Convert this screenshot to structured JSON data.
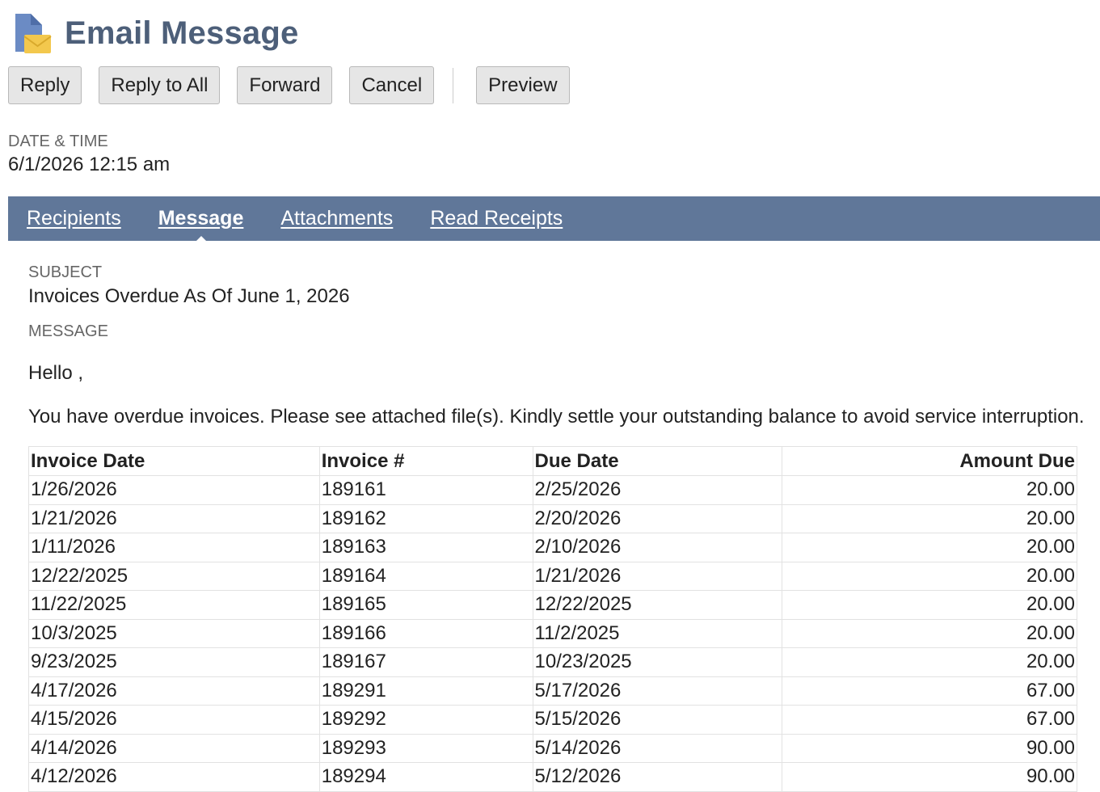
{
  "header": {
    "title": "Email Message",
    "icon": "email-message-icon"
  },
  "toolbar": {
    "reply_label": "Reply",
    "reply_all_label": "Reply to All",
    "forward_label": "Forward",
    "cancel_label": "Cancel",
    "preview_label": "Preview"
  },
  "datetime": {
    "label": "DATE & TIME",
    "value": "6/1/2026 12:15 am"
  },
  "tabs": {
    "recipients": "Recipients",
    "message": "Message",
    "attachments": "Attachments",
    "read_receipts": "Read Receipts",
    "active": "Message"
  },
  "subject": {
    "label": "SUBJECT",
    "value": "Invoices Overdue As Of June 1, 2026"
  },
  "message": {
    "label": "MESSAGE",
    "greeting": "Hello ,",
    "body": "You have overdue invoices. Please see attached file(s). Kindly settle your outstanding balance to avoid service interruption."
  },
  "table": {
    "headers": [
      "Invoice Date",
      "Invoice #",
      "Due Date",
      "Amount Due"
    ],
    "rows": [
      [
        "1/26/2026",
        "189161",
        "2/25/2026",
        "20.00"
      ],
      [
        "1/21/2026",
        "189162",
        "2/20/2026",
        "20.00"
      ],
      [
        "1/11/2026",
        "189163",
        "2/10/2026",
        "20.00"
      ],
      [
        "12/22/2025",
        "189164",
        "1/21/2026",
        "20.00"
      ],
      [
        "11/22/2025",
        "189165",
        "12/22/2025",
        "20.00"
      ],
      [
        "10/3/2025",
        "189166",
        "11/2/2025",
        "20.00"
      ],
      [
        "9/23/2025",
        "189167",
        "10/23/2025",
        "20.00"
      ],
      [
        "4/17/2026",
        "189291",
        "5/17/2026",
        "67.00"
      ],
      [
        "4/15/2026",
        "189292",
        "5/15/2026",
        "67.00"
      ],
      [
        "4/14/2026",
        "189293",
        "5/14/2026",
        "90.00"
      ],
      [
        "4/12/2026",
        "189294",
        "5/12/2026",
        "90.00"
      ]
    ]
  },
  "colors": {
    "title": "#4d5f79",
    "tabbar": "#607799",
    "button_bg": "#e6e6e6",
    "icon_blue": "#6b8bc4",
    "icon_yellow": "#f3c84d"
  }
}
